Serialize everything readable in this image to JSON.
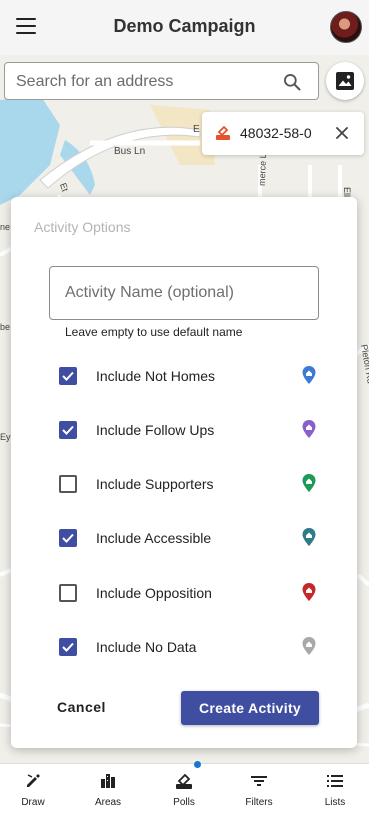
{
  "header": {
    "title": "Demo Campaign"
  },
  "search": {
    "placeholder": "Search for an address"
  },
  "chip": {
    "label": "48032-58-0"
  },
  "map": {
    "street_labels": [
      "Bus Ln",
      "E",
      "Et",
      "merce Ln",
      "Elle",
      "Pleton Rd",
      "be",
      "Ey",
      "ne"
    ]
  },
  "dialog": {
    "title": "Activity Options",
    "name_placeholder": "Activity Name (optional)",
    "helper_text": "Leave empty to use default name",
    "options": [
      {
        "label": "Include Not Homes",
        "checked": true,
        "pin_color": "#3b7bd6"
      },
      {
        "label": "Include Follow Ups",
        "checked": true,
        "pin_color": "#8a5fc9"
      },
      {
        "label": "Include Supporters",
        "checked": false,
        "pin_color": "#1d9a55"
      },
      {
        "label": "Include Accessible",
        "checked": true,
        "pin_color": "#2f7c86"
      },
      {
        "label": "Include Opposition",
        "checked": false,
        "pin_color": "#c62828"
      },
      {
        "label": "Include No Data",
        "checked": true,
        "pin_color": "#a8a8a8"
      }
    ],
    "cancel_label": "Cancel",
    "create_label": "Create Activity"
  },
  "nav": {
    "items": [
      {
        "label": "Draw",
        "icon": "draw-icon"
      },
      {
        "label": "Areas",
        "icon": "areas-icon"
      },
      {
        "label": "Polls",
        "icon": "polls-icon"
      },
      {
        "label": "Filters",
        "icon": "filters-icon"
      },
      {
        "label": "Lists",
        "icon": "lists-icon"
      }
    ]
  },
  "colors": {
    "primary": "#3f4ea1",
    "nav_indicator": "#1976d2"
  }
}
